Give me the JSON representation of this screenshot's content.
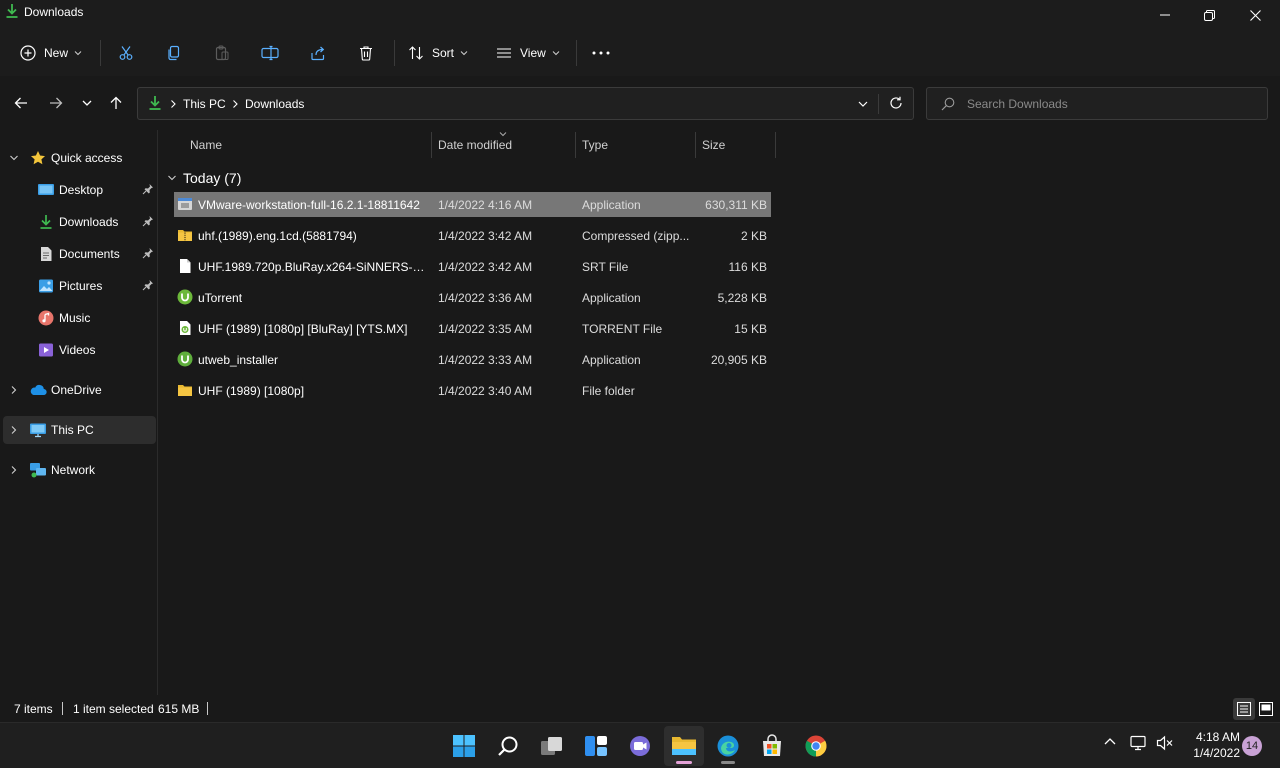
{
  "window": {
    "title": "Downloads",
    "controls": [
      "minimize",
      "restore",
      "close"
    ]
  },
  "commandbar": {
    "new_label": "New",
    "sort_label": "Sort",
    "view_label": "View",
    "icons": [
      "cut-icon",
      "copy-icon",
      "paste-icon",
      "rename-icon",
      "share-icon",
      "delete-icon",
      "more-icon"
    ]
  },
  "address": {
    "crumbs": [
      "This PC",
      "Downloads"
    ]
  },
  "search": {
    "placeholder": "Search Downloads"
  },
  "sidebar": {
    "items": [
      {
        "label": "Quick access"
      },
      {
        "label": "Desktop"
      },
      {
        "label": "Downloads"
      },
      {
        "label": "Documents"
      },
      {
        "label": "Pictures"
      },
      {
        "label": "Music"
      },
      {
        "label": "Videos"
      },
      {
        "label": "OneDrive"
      },
      {
        "label": "This PC"
      },
      {
        "label": "Network"
      }
    ]
  },
  "columns": [
    "Name",
    "Date modified",
    "Type",
    "Size"
  ],
  "group": {
    "label": "Today (7)"
  },
  "files": [
    {
      "name": "VMware-workstation-full-16.2.1-18811642",
      "date": "1/4/2022 4:16 AM",
      "type": "Application",
      "size": "630,311 KB",
      "icon": "installer-icon"
    },
    {
      "name": "uhf.(1989).eng.1cd.(5881794)",
      "date": "1/4/2022 3:42 AM",
      "type": "Compressed (zipp...",
      "size": "2 KB",
      "icon": "zip-folder-icon"
    },
    {
      "name": "UHF.1989.720p.BluRay.x264-SiNNERS-HI...",
      "date": "1/4/2022 3:42 AM",
      "type": "SRT File",
      "size": "116 KB",
      "icon": "file-icon"
    },
    {
      "name": "uTorrent",
      "date": "1/4/2022 3:36 AM",
      "type": "Application",
      "size": "5,228 KB",
      "icon": "utorrent-icon"
    },
    {
      "name": "UHF (1989) [1080p] [BluRay] [YTS.MX]",
      "date": "1/4/2022 3:35 AM",
      "type": "TORRENT File",
      "size": "15 KB",
      "icon": "torrent-file-icon"
    },
    {
      "name": "utweb_installer",
      "date": "1/4/2022 3:33 AM",
      "type": "Application",
      "size": "20,905 KB",
      "icon": "utweb-icon"
    },
    {
      "name": "UHF (1989) [1080p]",
      "date": "1/4/2022 3:40 AM",
      "type": "File folder",
      "size": "",
      "icon": "folder-icon"
    }
  ],
  "status": {
    "count": "7 items",
    "selection": "1 item selected",
    "selection_size": "615 MB"
  },
  "taskbar": {
    "time": "4:18 AM",
    "date": "1/4/2022",
    "notifications": "14"
  },
  "colors": {
    "accent": "#4cc2ff",
    "selected_row": "#777777",
    "folder": "#f5c542",
    "download_green": "#3fb950"
  }
}
